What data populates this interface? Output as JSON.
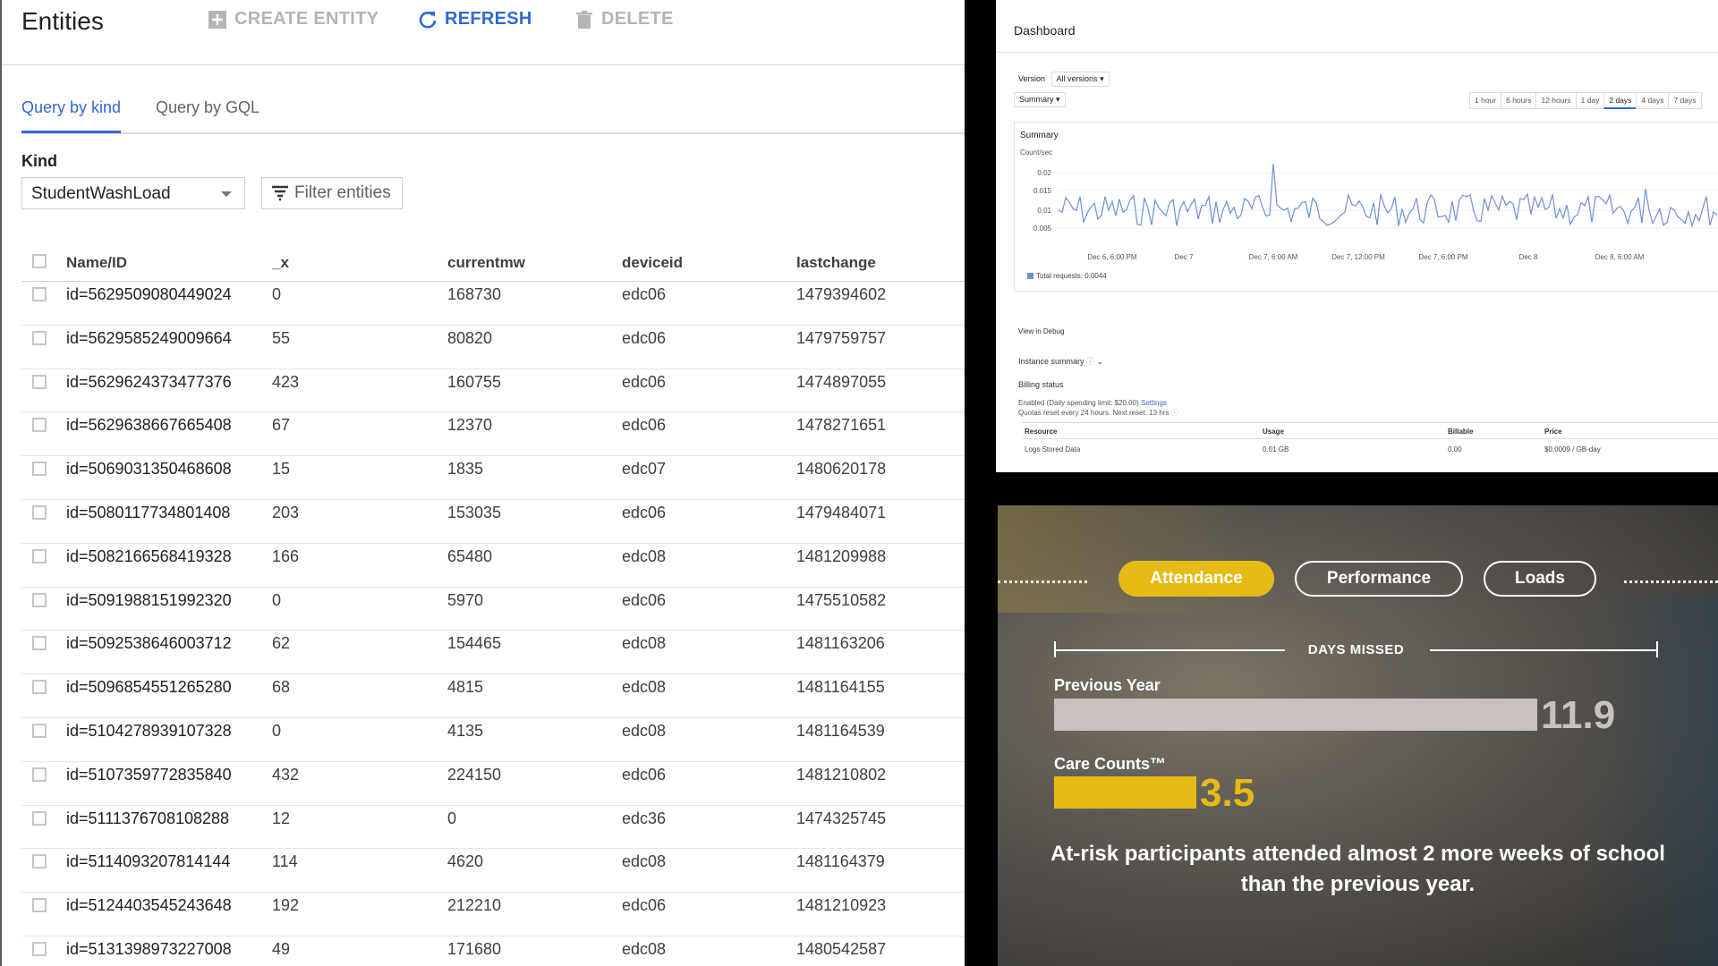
{
  "datastore": {
    "title": "Entities",
    "toolbar": {
      "create_label": "CREATE ENTITY",
      "refresh_label": "REFRESH",
      "delete_label": "DELETE"
    },
    "tabs": [
      "Query by kind",
      "Query by GQL"
    ],
    "kind_label": "Kind",
    "kind_value": "StudentWashLoad",
    "filter_label": "Filter entities",
    "columns": [
      "Name/ID",
      "_x",
      "currentmw",
      "deviceid",
      "lastchange"
    ],
    "rows": [
      [
        "id=5629509080449024",
        "0",
        "168730",
        "edc06",
        "1479394602"
      ],
      [
        "id=5629585249009664",
        "55",
        "80820",
        "edc06",
        "1479759757"
      ],
      [
        "id=5629624373477376",
        "423",
        "160755",
        "edc06",
        "1474897055"
      ],
      [
        "id=5629638667665408",
        "67",
        "12370",
        "edc06",
        "1478271651"
      ],
      [
        "id=5069031350468608",
        "15",
        "1835",
        "edc07",
        "1480620178"
      ],
      [
        "id=5080117734801408",
        "203",
        "153035",
        "edc06",
        "1479484071"
      ],
      [
        "id=5082166568419328",
        "166",
        "65480",
        "edc08",
        "1481209988"
      ],
      [
        "id=5091988151992320",
        "0",
        "5970",
        "edc06",
        "1475510582"
      ],
      [
        "id=5092538646003712",
        "62",
        "154465",
        "edc08",
        "1481163206"
      ],
      [
        "id=5096854551265280",
        "68",
        "4815",
        "edc08",
        "1481164155"
      ],
      [
        "id=5104278939107328",
        "0",
        "4135",
        "edc08",
        "1481164539"
      ],
      [
        "id=5107359772835840",
        "432",
        "224150",
        "edc06",
        "1481210802"
      ],
      [
        "id=5111376708108288",
        "12",
        "0",
        "edc36",
        "1474325745"
      ],
      [
        "id=5114093207814144",
        "114",
        "4620",
        "edc08",
        "1481164379"
      ],
      [
        "id=5124403545243648",
        "192",
        "212210",
        "edc06",
        "1481210923"
      ],
      [
        "id=5131398973227008",
        "49",
        "171680",
        "edc08",
        "1480542587"
      ]
    ]
  },
  "dashboard": {
    "title": "Dashboard",
    "version_label": "Version",
    "version_value": "All versions",
    "view_value": "Summary",
    "time_ranges": [
      "1 hour",
      "6 hours",
      "12 hours",
      "1 day",
      "2 days",
      "4 days",
      "7 days"
    ],
    "selected_range": "2 days",
    "summary_title": "Summary",
    "summary_unit": "Count/sec",
    "y_ticks": [
      "0.02",
      "0.015",
      "0.01",
      "0.005"
    ],
    "x_ticks": [
      "Dec 6, 6:00 PM",
      "Dec 7",
      "Dec 7, 6:00 AM",
      "Dec 7, 12:00 PM",
      "Dec 7, 6:00 PM",
      "Dec 8",
      "Dec 8, 6:00 AM"
    ],
    "legend": "Total requests: 0.0044",
    "series_color": "#6f8fd8",
    "view_in_debug": "View in Debug",
    "instance_summary": "Instance summary",
    "billing_status": "Billing status",
    "billing_line1": "Enabled (Daily spending limit: $20.00)",
    "billing_settings": "Settings",
    "billing_line2": "Quotas reset every 24 hours. Next reset: 13 hrs",
    "billing_columns": [
      "Resource",
      "Usage",
      "Billable",
      "Price"
    ],
    "billing_row": [
      "Logs Stored Data",
      "0.01 GB",
      "0.00",
      "$0.0009 / GB-day"
    ]
  },
  "infographic": {
    "tabs": [
      "Attendance",
      "Performance",
      "Loads"
    ],
    "active_tab": "Attendance",
    "days_missed": "DAYS MISSED",
    "bars": [
      {
        "label": "Previous Year",
        "value": 11.9,
        "display": "11.9",
        "color": "#c8c1bf"
      },
      {
        "label": "Care Counts™",
        "value": 3.5,
        "display": "3.5",
        "color": "#e6bb16"
      }
    ],
    "caption": "At-risk participants attended almost 2 more weeks of school than the previous year."
  }
}
